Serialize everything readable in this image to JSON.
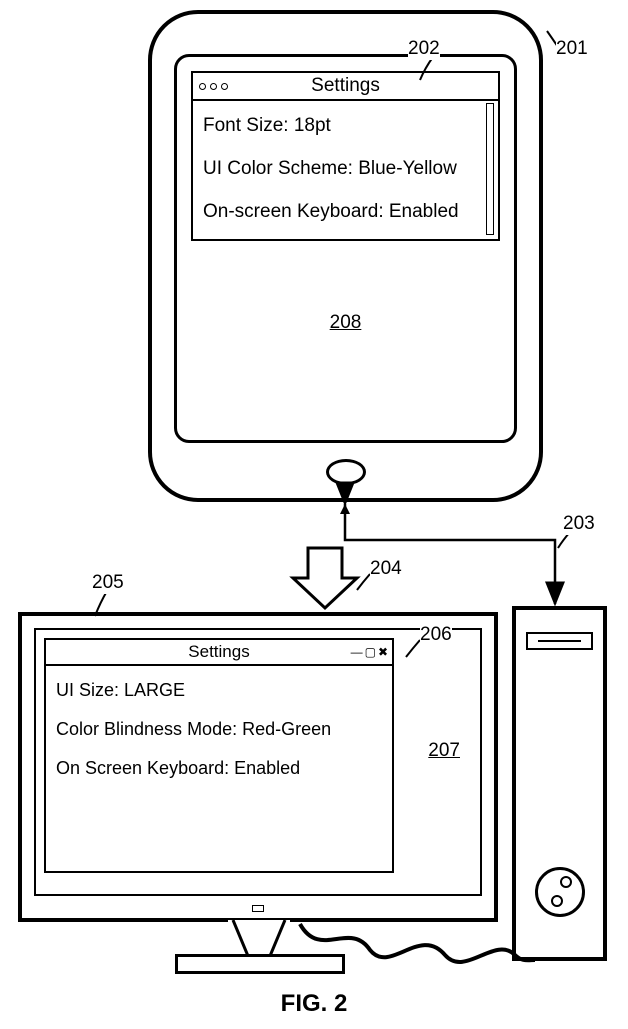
{
  "figure_label": "FIG. 2",
  "refs": {
    "r201": "201",
    "r202": "202",
    "r203": "203",
    "r204": "204",
    "r205": "205",
    "r206": "206",
    "r207": "207",
    "r208": "208"
  },
  "tablet": {
    "window_title": "Settings",
    "settings": [
      "Font Size: 18pt",
      "UI Color Scheme: Blue-Yellow",
      "On-screen Keyboard: Enabled"
    ]
  },
  "desktop": {
    "window_title": "Settings",
    "settings": [
      "UI Size: LARGE",
      "Color Blindness Mode: Red-Green",
      "On Screen Keyboard: Enabled"
    ]
  }
}
